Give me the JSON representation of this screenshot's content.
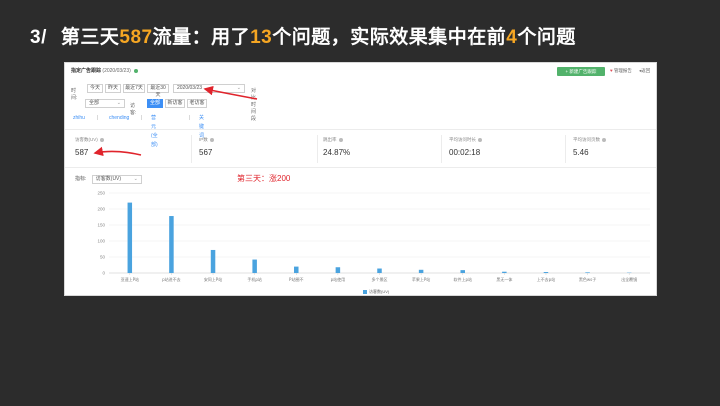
{
  "slide": {
    "number": "3/",
    "title_parts": [
      {
        "text": "第三天",
        "hl": false
      },
      {
        "text": "587",
        "hl": true
      },
      {
        "text": "流量：用了",
        "hl": false
      },
      {
        "text": "13",
        "hl": true
      },
      {
        "text": "个问题，实际效果集中在前",
        "hl": false
      },
      {
        "text": "4",
        "hl": true
      },
      {
        "text": "个问题",
        "hl": false
      }
    ]
  },
  "screenshot": {
    "page_name": "指定广告跟踪",
    "page_date": "(2020/03/23)",
    "add_button": "+ 新建广告跟踪",
    "links": {
      "manage": "管理报告",
      "exit": "返回"
    },
    "time_label": "时间:",
    "time_ranges": [
      "今天",
      "昨天",
      "最近7天",
      "最近30天"
    ],
    "date_value": "2020/03/23",
    "compare_label": "对比时间段",
    "device_select": "全部",
    "visitor_label": "访客:",
    "visitor_types": [
      "全部",
      "新访客",
      "老访客"
    ],
    "filters": [
      "zhihu",
      "chending",
      "营元 (全部)",
      "关键词"
    ],
    "metrics": [
      {
        "label": "访客数(UV)",
        "value": "587"
      },
      {
        "label": "IP数",
        "value": "567"
      },
      {
        "label": "跳出率",
        "value": "24.87%"
      },
      {
        "label": "平均访问时长",
        "value": "00:02:18"
      },
      {
        "label": "平均访问页数",
        "value": "5.46"
      }
    ],
    "metric_selector_label": "指标:",
    "metric_selector_value": "访客数(UV)",
    "annotation": "第三天：涨200"
  },
  "chart_data": {
    "type": "bar",
    "categories": [
      "亚速上P站",
      "p站进不去",
      "安同上P站",
      "手机p站",
      "P站圈不",
      "p站使用",
      "多个景区",
      "苹果上P站",
      "软件上p站",
      "黑无一体",
      "上不去p站",
      "黑色ws子",
      "出全覆镜"
    ],
    "values": [
      220,
      178,
      72,
      42,
      20,
      18,
      14,
      10,
      9,
      4,
      3,
      2,
      1
    ],
    "ylim": [
      0,
      250
    ],
    "yticks": [
      0,
      50,
      100,
      150,
      200,
      250
    ],
    "legend": "访客数(UV)",
    "bar_color": "#4aa3df"
  }
}
